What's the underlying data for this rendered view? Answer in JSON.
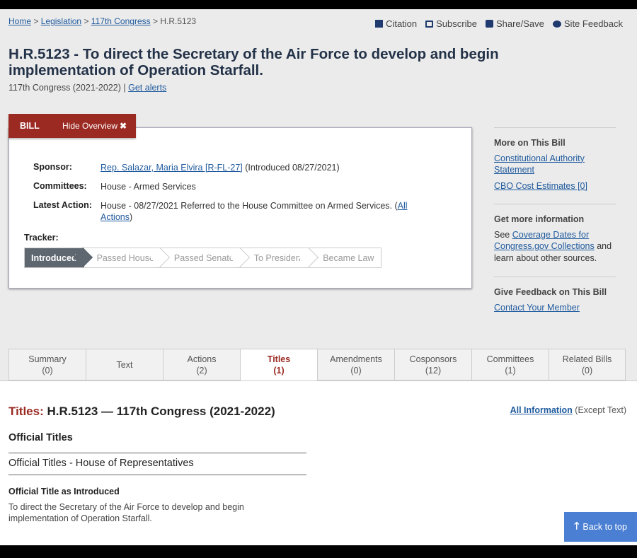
{
  "breadcrumb": {
    "items": [
      "Home",
      "Legislation",
      "117th Congress"
    ],
    "current": "H.R.5123"
  },
  "utils": {
    "citation": "Citation",
    "subscribe": "Subscribe",
    "share": "Share/Save",
    "feedback": "Site Feedback"
  },
  "bill": {
    "title": "H.R.5123 - To direct the Secretary of the Air Force to develop and begin implementation of Operation Starfall.",
    "congress": "117th Congress (2021-2022)",
    "separator": "|",
    "get_alerts": "Get alerts"
  },
  "overview": {
    "tab_label": "BILL",
    "hide_label": "Hide Overview",
    "sponsor_label": "Sponsor:",
    "sponsor_link": "Rep. Salazar, Maria Elvira [R-FL-27]",
    "sponsor_intro": " (Introduced 08/27/2021)",
    "committees_label": "Committees:",
    "committees_value": "House - Armed Services",
    "latest_label": "Latest Action:",
    "latest_value": "House - 08/27/2021 Referred to the House Committee on Armed Services.  (",
    "all_actions": "All Actions",
    "latest_close": ")",
    "tracker_label": "Tracker:",
    "tracker": [
      "Introduced",
      "Passed House",
      "Passed Senate",
      "To President",
      "Became Law"
    ]
  },
  "sidebar": {
    "more_title": "More on This Bill",
    "constitutional": "Constitutional Authority Statement",
    "cbo": "CBO Cost Estimates [0]",
    "info_title": "Get more information",
    "info_pre": "See ",
    "coverage_link": "Coverage Dates for Congress.gov Collections",
    "info_post": " and learn about other sources.",
    "feedback_title": "Give Feedback on This Bill",
    "contact": "Contact Your Member"
  },
  "tabs": [
    {
      "label": "Summary",
      "count": "(0)"
    },
    {
      "label": "Text",
      "count": ""
    },
    {
      "label": "Actions",
      "count": "(2)"
    },
    {
      "label": "Titles",
      "count": "(1)"
    },
    {
      "label": "Amendments",
      "count": "(0)"
    },
    {
      "label": "Cosponsors",
      "count": "(12)"
    },
    {
      "label": "Committees",
      "count": "(1)"
    },
    {
      "label": "Related Bills",
      "count": "(0)"
    }
  ],
  "content": {
    "heading_prefix": "Titles:",
    "heading": " H.R.5123 — 117th Congress (2021-2022)",
    "all_info": "All Information",
    "except_text": " (Except Text)",
    "official_titles": "Official Titles",
    "house_label": "Official Titles - House of Representatives",
    "intro_label": "Official Title as Introduced",
    "intro_text": "To direct the Secretary of the Air Force to develop and begin implementation of Operation Starfall."
  },
  "back_to_top": "Back to top"
}
